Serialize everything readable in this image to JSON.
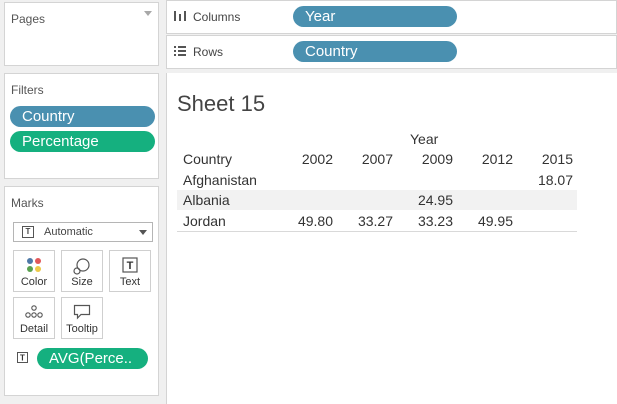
{
  "pages": {
    "title": "Pages"
  },
  "filters": {
    "title": "Filters",
    "items": [
      {
        "label": "Country",
        "color": "#4a90b0"
      },
      {
        "label": "Percentage",
        "color": "#15b07f"
      }
    ]
  },
  "marks": {
    "title": "Marks",
    "mark_type": "Automatic",
    "cards": [
      {
        "label": "Color",
        "icon": "color-dots-icon"
      },
      {
        "label": "Size",
        "icon": "size-circles-icon"
      },
      {
        "label": "Text",
        "icon": "text-t-icon"
      },
      {
        "label": "Detail",
        "icon": "detail-dots-icon"
      },
      {
        "label": "Tooltip",
        "icon": "tooltip-bubble-icon"
      }
    ],
    "field_pill": "AVG(Perce.."
  },
  "shelves": {
    "columns": {
      "label": "Columns",
      "pill": "Year"
    },
    "rows": {
      "label": "Rows",
      "pill": "Country"
    }
  },
  "sheet": {
    "title": "Sheet 15",
    "column_group_header": "Year",
    "row_header": "Country",
    "years": [
      "2002",
      "2007",
      "2009",
      "2012",
      "2015"
    ],
    "rows": [
      {
        "country": "Afghanistan",
        "values": [
          "",
          "",
          "",
          "",
          "18.07"
        ]
      },
      {
        "country": "Albania",
        "values": [
          "",
          "",
          "24.95",
          "",
          ""
        ]
      },
      {
        "country": "Jordan",
        "values": [
          "49.80",
          "33.27",
          "33.23",
          "49.95",
          ""
        ]
      }
    ]
  },
  "colors": {
    "dimension_pill": "#4a90b0",
    "measure_pill": "#15b07f",
    "band": "#f2f2f2"
  }
}
